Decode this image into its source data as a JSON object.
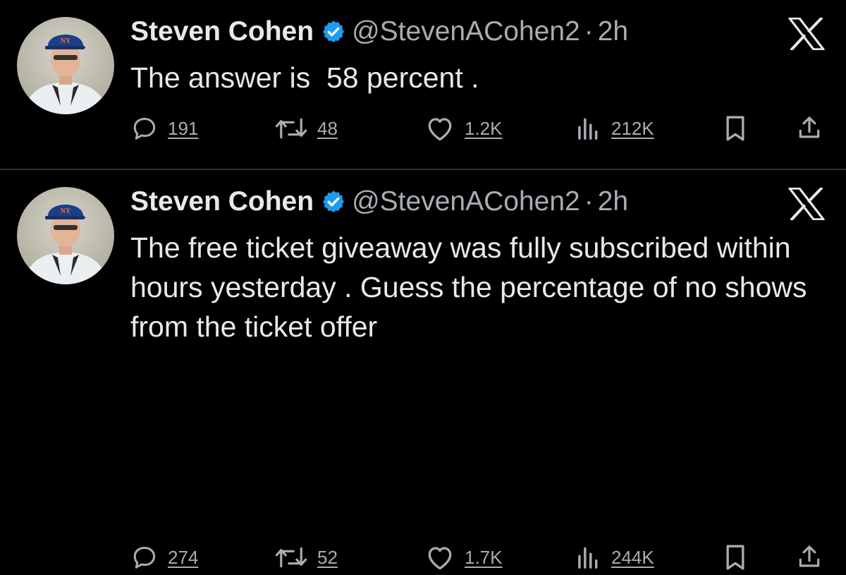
{
  "tweets": [
    {
      "author_name": "Steven Cohen",
      "handle": "@StevenACohen2",
      "separator": "·",
      "time": "2h",
      "text": "The answer is  58 percent .",
      "replies": "191",
      "retweets": "48",
      "likes": "1.2K",
      "views": "212K"
    },
    {
      "author_name": "Steven Cohen",
      "handle": "@StevenACohen2",
      "separator": "·",
      "time": "2h",
      "text": "The free ticket giveaway was fully subscribed within hours yesterday . Guess the percentage of no shows from the ticket offer",
      "replies": "274",
      "retweets": "52",
      "likes": "1.7K",
      "views": "244K"
    }
  ],
  "colors": {
    "background": "#000000",
    "text_primary": "#e7e9ea",
    "text_secondary": "#a7adb3",
    "verified_badge": "#1d9bf0",
    "divider": "#2f3336"
  },
  "icons": [
    "avatar",
    "verified-badge-icon",
    "x-logo-icon",
    "reply-icon",
    "retweet-icon",
    "like-icon",
    "views-icon",
    "bookmark-icon",
    "share-icon"
  ]
}
